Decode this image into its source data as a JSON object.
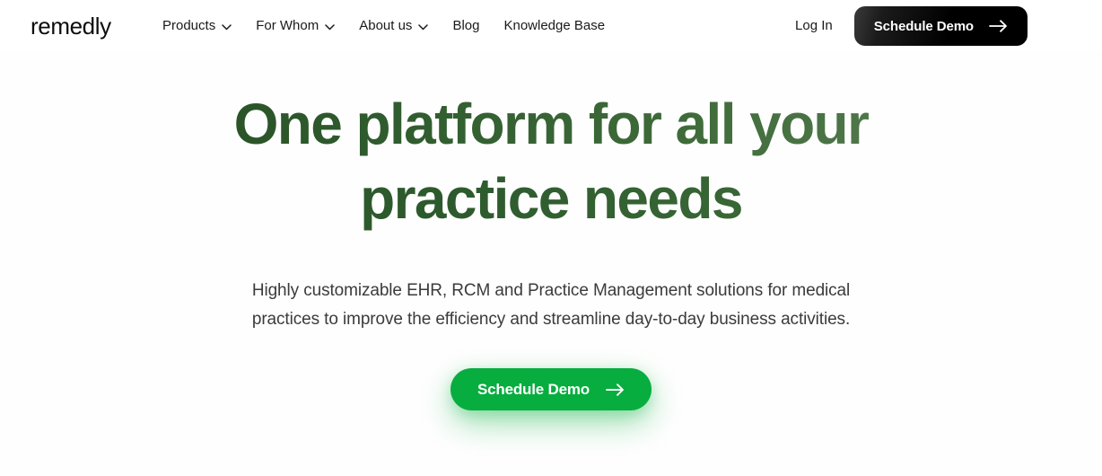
{
  "brand": {
    "logo_text": "remedly"
  },
  "nav": {
    "items": [
      {
        "label": "Products",
        "has_chevron": true,
        "icon": "chevron-down-icon"
      },
      {
        "label": "For Whom",
        "has_chevron": true,
        "icon": "chevron-down-icon"
      },
      {
        "label": "About us",
        "has_chevron": true,
        "icon": "chevron-down-icon"
      },
      {
        "label": "Blog",
        "has_chevron": false,
        "icon": ""
      },
      {
        "label": "Knowledge Base",
        "has_chevron": false,
        "icon": ""
      }
    ],
    "login_label": "Log In",
    "cta_label": "Schedule Demo",
    "cta_icon": "arrow-right-icon",
    "cta_background": "#000000",
    "cta_text_color": "#ffffff"
  },
  "hero": {
    "headline_line1": "One platform for all your",
    "headline_line2": "practice needs",
    "headline_color_start": "#2d5a2d",
    "headline_color_end": "#62855c",
    "subheadline_line1": "Highly customizable EHR, RCM and Practice Management solutions for medical",
    "subheadline_line2": "practices to improve the efficiency and streamline day-to-day business activities.",
    "subheadline_color": "#3b3b3b",
    "cta_label": "Schedule Demo",
    "cta_icon": "arrow-right-icon",
    "cta_background": "#07ad3e",
    "cta_text_color": "#ffffff"
  },
  "page": {
    "background": "#fefefe"
  }
}
